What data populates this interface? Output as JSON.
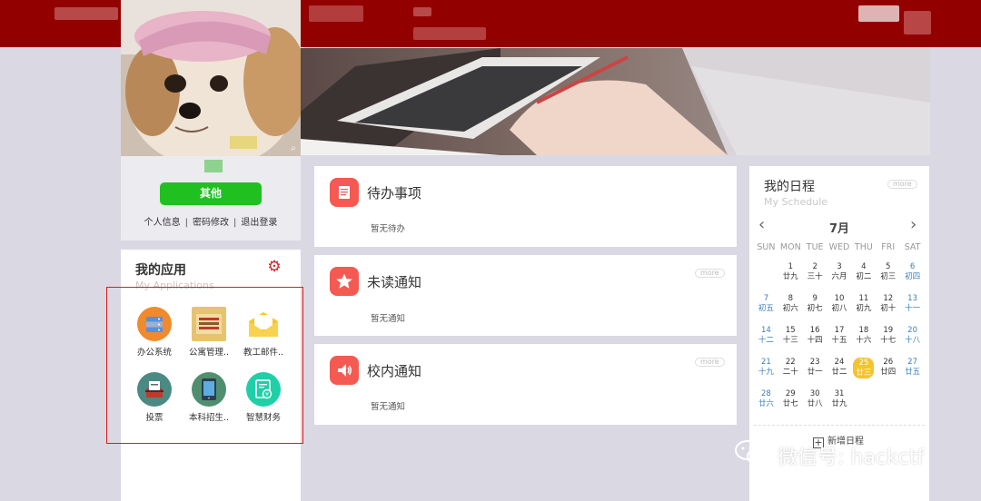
{
  "profile": {
    "other_button": "其他",
    "links": [
      "个人信息",
      "密码修改",
      "退出登录"
    ]
  },
  "apps": {
    "title": "我的应用",
    "subtitle": "My Applications",
    "items": [
      {
        "label": "办公系统",
        "icon": "server-icon",
        "color": "#f08a2c"
      },
      {
        "label": "公寓管理..",
        "icon": "building-icon",
        "color": "#e7c36f"
      },
      {
        "label": "教工邮件..",
        "icon": "envelope-icon",
        "color": "#f7c52a"
      },
      {
        "label": "投票",
        "icon": "ballot-icon",
        "color": "#4a8a83"
      },
      {
        "label": "本科招生..",
        "icon": "tablet-icon",
        "color": "#4f8f6f"
      },
      {
        "label": "智慧财务",
        "icon": "finance-doc-icon",
        "color": "#1fcfa8"
      }
    ]
  },
  "cards": [
    {
      "title": "待办事项",
      "empty": "暂无待办",
      "icon": "todo-list-icon",
      "more": ""
    },
    {
      "title": "未读通知",
      "empty": "暂无通知",
      "icon": "star-icon",
      "more": "more"
    },
    {
      "title": "校内通知",
      "empty": "暂无通知",
      "icon": "megaphone-icon",
      "more": "more"
    }
  ],
  "schedule": {
    "title": "我的日程",
    "subtitle": "My Schedule",
    "more": "more",
    "month": "7月",
    "prev": "‹",
    "next": "›",
    "weekdays": [
      "SUN",
      "MON",
      "TUE",
      "WED",
      "THU",
      "FRI",
      "SAT"
    ],
    "weeks": [
      [
        null,
        {
          "d": "1",
          "l": "廿九"
        },
        {
          "d": "2",
          "l": "三十"
        },
        {
          "d": "3",
          "l": "六月"
        },
        {
          "d": "4",
          "l": "初二"
        },
        {
          "d": "5",
          "l": "初三"
        },
        {
          "d": "6",
          "l": "初四"
        }
      ],
      [
        {
          "d": "7",
          "l": "初五"
        },
        {
          "d": "8",
          "l": "初六"
        },
        {
          "d": "9",
          "l": "初七"
        },
        {
          "d": "10",
          "l": "初八"
        },
        {
          "d": "11",
          "l": "初九"
        },
        {
          "d": "12",
          "l": "初十"
        },
        {
          "d": "13",
          "l": "十一"
        }
      ],
      [
        {
          "d": "14",
          "l": "十二"
        },
        {
          "d": "15",
          "l": "十三"
        },
        {
          "d": "16",
          "l": "十四"
        },
        {
          "d": "17",
          "l": "十五"
        },
        {
          "d": "18",
          "l": "十六"
        },
        {
          "d": "19",
          "l": "十七"
        },
        {
          "d": "20",
          "l": "十八"
        }
      ],
      [
        {
          "d": "21",
          "l": "十九"
        },
        {
          "d": "22",
          "l": "二十"
        },
        {
          "d": "23",
          "l": "廿一"
        },
        {
          "d": "24",
          "l": "廿二"
        },
        {
          "d": "25",
          "l": "廿三"
        },
        {
          "d": "26",
          "l": "廿四"
        },
        {
          "d": "27",
          "l": "廿五"
        }
      ],
      [
        {
          "d": "28",
          "l": "廿六"
        },
        {
          "d": "29",
          "l": "廿七"
        },
        {
          "d": "30",
          "l": "廿八"
        },
        {
          "d": "31",
          "l": "廿九"
        },
        null,
        null,
        null
      ]
    ],
    "today": "25",
    "add_label": "新增日程"
  },
  "watermark": "微信号: hackctf",
  "colors": {
    "topbar": "#930000",
    "green_button": "#21c021",
    "card_icon": "#f45a52",
    "today": "#f4c430",
    "weekend": "#3a7ebf"
  }
}
